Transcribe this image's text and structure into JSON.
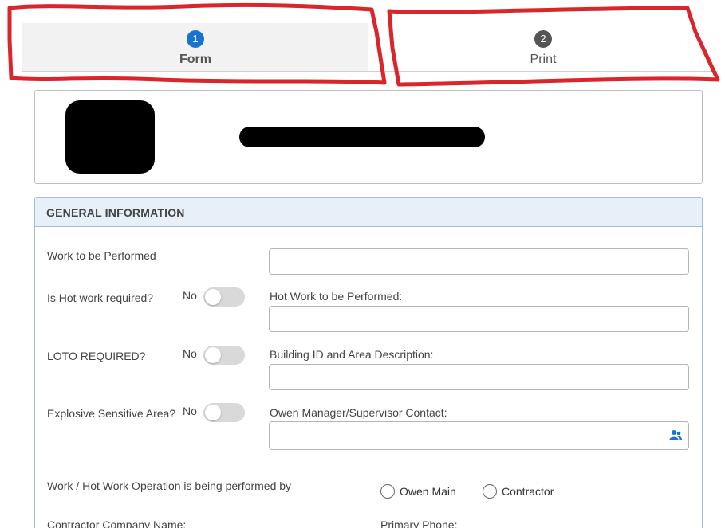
{
  "steps": [
    {
      "number": "1",
      "label": "Form",
      "active": true
    },
    {
      "number": "2",
      "label": "Print",
      "active": false
    }
  ],
  "panel": {
    "title": "GENERAL INFORMATION"
  },
  "fields": {
    "work_to_be_performed": {
      "label": "Work to be Performed",
      "value": ""
    },
    "hot_work_required": {
      "label": "Is Hot work required?",
      "state": "No"
    },
    "hot_work_to_be_performed": {
      "label": "Hot Work to be Performed:",
      "value": ""
    },
    "loto_required": {
      "label": "LOTO REQUIRED?",
      "state": "No"
    },
    "building_id": {
      "label": "Building ID and Area Description:",
      "value": ""
    },
    "explosive_sensitive": {
      "label": "Explosive Sensitive Area?",
      "state": "No"
    },
    "manager_contact": {
      "label": "Owen Manager/Supervisor Contact:",
      "value": "",
      "icon": "people-icon"
    },
    "performed_by": {
      "label": "Work / Hot Work Operation is being performed by",
      "options": [
        "Owen Main",
        "Contractor"
      ]
    },
    "contractor_company": {
      "label": "Contractor Company Name:"
    },
    "primary_phone": {
      "label": "Primary Phone:"
    }
  },
  "colors": {
    "active_step": "#1a73d1",
    "inactive_step": "#555555",
    "panel_header_bg": "#e7eff9",
    "annotation": "#d9262b"
  }
}
